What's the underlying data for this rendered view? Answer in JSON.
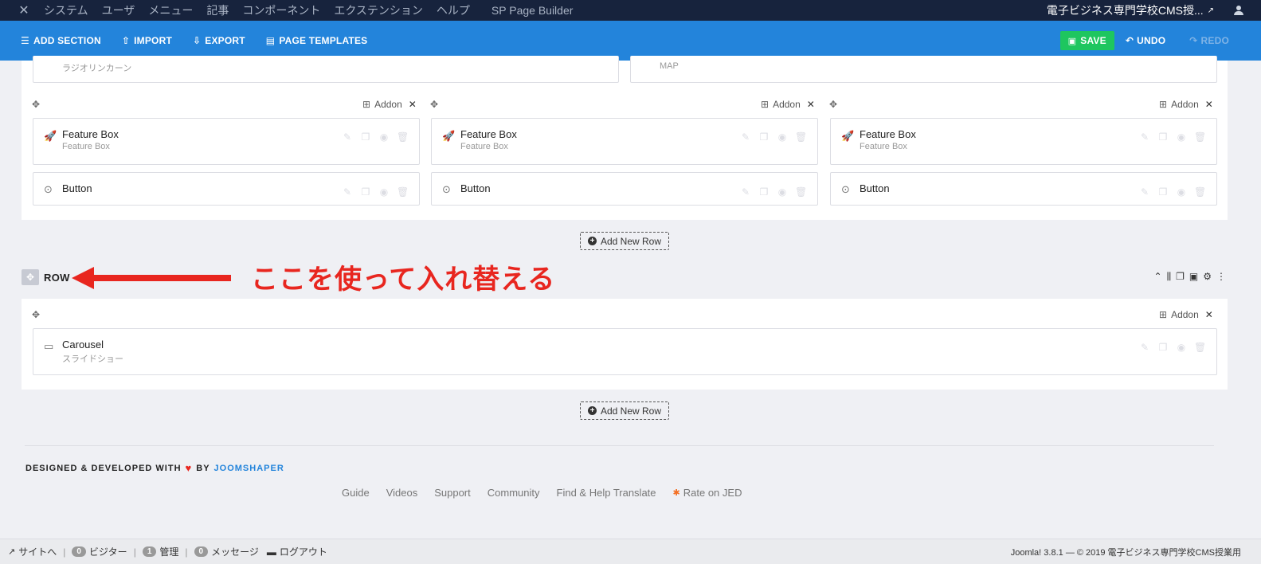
{
  "admin_bar": {
    "logo_icon": "joomla-icon",
    "menu": [
      "システム",
      "ユーザ",
      "メニュー",
      "記事",
      "コンポーネント",
      "エクステンション",
      "ヘルプ",
      "SP Page Builder"
    ],
    "site_name": "電子ビジネス専門学校CMS授...",
    "ext_icon": "external-link-icon",
    "user_icon": "user-icon"
  },
  "toolbar": {
    "add_section": "ADD SECTION",
    "import": "IMPORT",
    "export": "EXPORT",
    "page_templates": "PAGE TEMPLATES",
    "save": "SAVE",
    "undo": "UNDO",
    "redo": "REDO"
  },
  "top_partial": {
    "left_subtitle": "ラジオリンカーン",
    "right_subtitle": "MAP"
  },
  "three_col_row": {
    "addon_label": "Addon",
    "columns": [
      {
        "feature_title": "Feature Box",
        "feature_sub": "Feature Box",
        "button_title": "Button"
      },
      {
        "feature_title": "Feature Box",
        "feature_sub": "Feature Box",
        "button_title": "Button"
      },
      {
        "feature_title": "Feature Box",
        "feature_sub": "Feature Box",
        "button_title": "Button"
      }
    ]
  },
  "add_new_row": "Add New Row",
  "row": {
    "label": "ROW",
    "annotation": "ここを使って入れ替える",
    "annotation_color": "#e8261f",
    "addon_label": "Addon",
    "carousel_title": "Carousel",
    "carousel_sub": "スライドショー"
  },
  "credits": {
    "prefix": "DESIGNED & DEVELOPED WITH",
    "by": "BY",
    "brand": "JOOMSHAPER"
  },
  "footer_links": [
    "Guide",
    "Videos",
    "Support",
    "Community",
    "Find & Help Translate",
    "Rate on JED"
  ],
  "status_bar": {
    "view_site": "サイトへ",
    "visitors_count": "0",
    "visitors": "ビジター",
    "admin_count": "1",
    "admin": "管理",
    "messages_count": "0",
    "messages": "メッセージ",
    "logout": "ログアウト",
    "copyright": "Joomla! 3.8.1 — © 2019 電子ビジネス専門学校CMS授業用"
  },
  "colors": {
    "admin_bar_bg": "#17233d",
    "toolbar_bg": "#2384db",
    "save_bg": "#1ec65f",
    "accent_link": "#2384db"
  }
}
